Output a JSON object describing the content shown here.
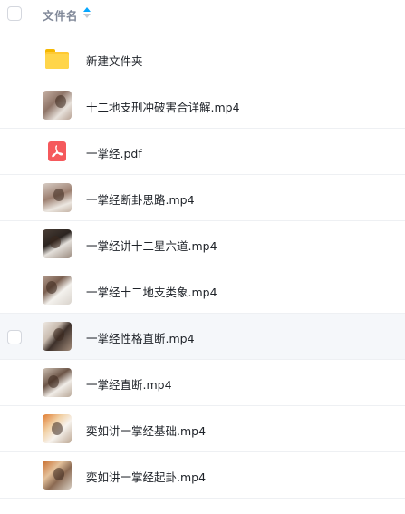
{
  "header": {
    "column_label": "文件名",
    "sort_icon": "sort-asc-icon",
    "accent_color": "#06a7ff"
  },
  "files": [
    {
      "name": "新建文件夹",
      "type": "folder",
      "icon": "folder-icon"
    },
    {
      "name": "十二地支刑冲破害合详解.mp4",
      "type": "video",
      "icon": "video-thumbnail"
    },
    {
      "name": "一掌经.pdf",
      "type": "pdf",
      "icon": "pdf-icon"
    },
    {
      "name": "一掌经断卦思路.mp4",
      "type": "video",
      "icon": "video-thumbnail"
    },
    {
      "name": "一掌经讲十二星六道.mp4",
      "type": "video",
      "icon": "video-thumbnail"
    },
    {
      "name": "一掌经十二地支类象.mp4",
      "type": "video",
      "icon": "video-thumbnail"
    },
    {
      "name": "一掌经性格直断.mp4",
      "type": "video",
      "icon": "video-thumbnail",
      "hovered": true
    },
    {
      "name": "一掌经直断.mp4",
      "type": "video",
      "icon": "video-thumbnail"
    },
    {
      "name": "奕如讲一掌经基础.mp4",
      "type": "video",
      "icon": "video-thumbnail"
    },
    {
      "name": "奕如讲一掌经起卦.mp4",
      "type": "video",
      "icon": "video-thumbnail"
    }
  ]
}
